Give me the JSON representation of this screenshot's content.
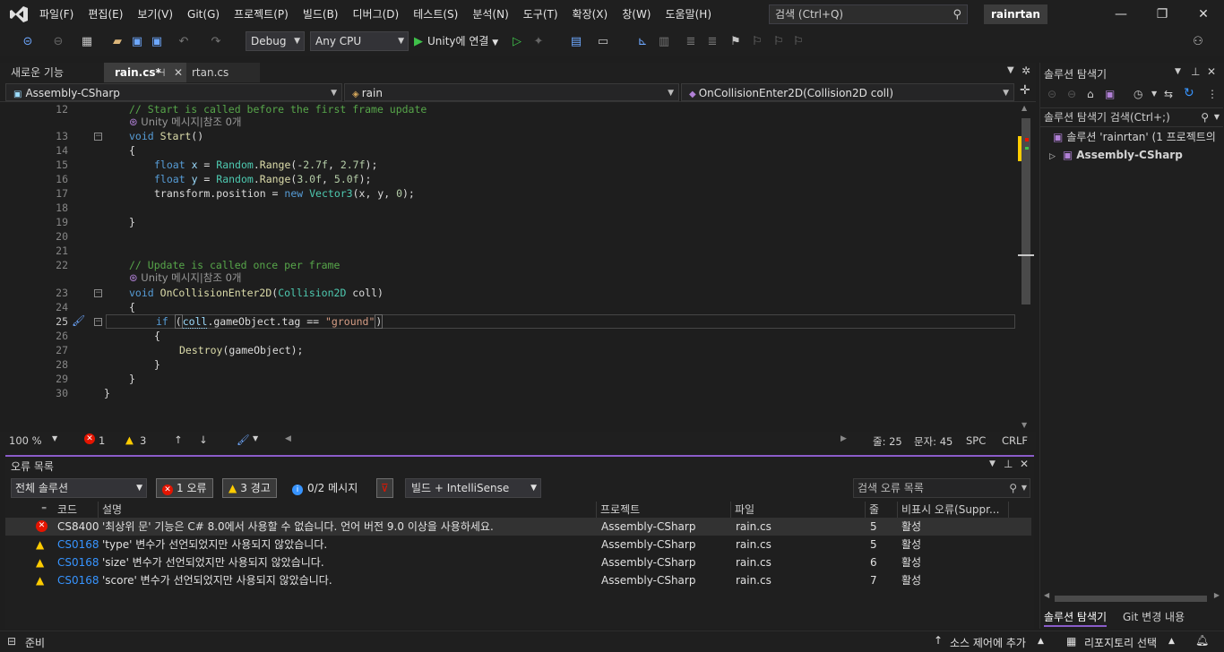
{
  "menu": {
    "items": [
      "파일(F)",
      "편집(E)",
      "보기(V)",
      "Git(G)",
      "프로젝트(P)",
      "빌드(B)",
      "디버그(D)",
      "테스트(S)",
      "분석(N)",
      "도구(T)",
      "확장(X)",
      "창(W)",
      "도움말(H)"
    ],
    "search_placeholder": "검색 (Ctrl+Q)",
    "solution_name": "rainrtan"
  },
  "toolbar": {
    "config": "Debug",
    "platform": "Any CPU",
    "run_label": "Unity에 연결"
  },
  "tabs": {
    "new_features": "새로운 기능",
    "active": "rain.cs*",
    "other": "rtan.cs"
  },
  "navbar": {
    "project": "Assembly-CSharp",
    "type": "rain",
    "member": "OnCollisionEnter2D(Collision2D coll)"
  },
  "code": {
    "line_numbers": [
      "12",
      "13",
      "14",
      "15",
      "16",
      "17",
      "18",
      "19",
      "20",
      "21",
      "22",
      "23",
      "24",
      "25",
      "26",
      "27",
      "28",
      "29",
      "30"
    ],
    "l12": "// Start is called before the first frame update",
    "lens1": "Unity 메시지|참조 0개",
    "l13a": "void",
    "l13b": "Start",
    "l13c": "()",
    "l14": "{",
    "l15a": "float",
    "l15b": "x",
    "l15c": " = ",
    "l15d": "Random",
    "l15e": ".",
    "l15f": "Range",
    "l15g": "(-",
    "l15h": "2.7f",
    "l15i": ", ",
    "l15j": "2.7f",
    "l15k": ");",
    "l16a": "float",
    "l16b": "y",
    "l16c": " = ",
    "l16d": "Random",
    "l16e": ".",
    "l16f": "Range",
    "l16g": "(",
    "l16h": "3.0f",
    "l16i": ", ",
    "l16j": "5.0f",
    "l16k": ");",
    "l17a": "transform.position = ",
    "l17b": "new",
    "l17c": "Vector3",
    "l17d": "(x, y, ",
    "l17e": "0",
    "l17f": ");",
    "l19": "}",
    "l22": "// Update is called once per frame",
    "lens2": "Unity 메시지|참조 0개",
    "l23a": "void",
    "l23b": "OnCollisionEnter2D",
    "l23c": "(",
    "l23d": "Collision2D",
    "l23e": " coll)",
    "l24": "{",
    "l25a": "if",
    "l25b": "(",
    "l25c": "coll",
    "l25d": ".gameObject.tag == ",
    "l25e": "\"ground\"",
    "l25f": ")",
    "l26": "{",
    "l27a": "Destroy",
    "l27b": "(gameObject);",
    "l28": "}",
    "l29": "}",
    "l30": "}"
  },
  "editor_status": {
    "zoom": "100 %",
    "errors": "1",
    "warnings": "3",
    "line": "줄: 25",
    "col": "문자: 45",
    "spc": "SPC",
    "crlf": "CRLF"
  },
  "error_list": {
    "title": "오류 목록",
    "scope": "전체 솔루션",
    "errors_btn": "1 오류",
    "warnings_btn": "3 경고",
    "messages_btn": "0/2 메시지",
    "build_filter": "빌드 + IntelliSense",
    "search_placeholder": "검색 오류 목록",
    "headers": {
      "code": "코드",
      "desc": "설명",
      "project": "프로젝트",
      "file": "파일",
      "line": "줄",
      "suppress": "비표시 오류(Suppr..."
    },
    "rows": [
      {
        "code": "CS8400",
        "desc": "'최상위 문' 기능은 C# 8.0에서 사용할 수 없습니다. 언어 버전 9.0 이상을 사용하세요.",
        "project": "Assembly-CSharp",
        "file": "rain.cs",
        "line": "5",
        "state": "활성"
      },
      {
        "code": "CS0168",
        "desc": "'type' 변수가 선언되었지만 사용되지 않았습니다.",
        "project": "Assembly-CSharp",
        "file": "rain.cs",
        "line": "5",
        "state": "활성"
      },
      {
        "code": "CS0168",
        "desc": "'size' 변수가 선언되었지만 사용되지 않았습니다.",
        "project": "Assembly-CSharp",
        "file": "rain.cs",
        "line": "6",
        "state": "활성"
      },
      {
        "code": "CS0168",
        "desc": "'score' 변수가 선언되었지만 사용되지 않았습니다.",
        "project": "Assembly-CSharp",
        "file": "rain.cs",
        "line": "7",
        "state": "활성"
      }
    ]
  },
  "solution_explorer": {
    "title": "솔루션 탐색기",
    "search_placeholder": "솔루션 탐색기 검색(Ctrl+;)",
    "solution_node": "솔루션 'rainrtan' (1 프로젝트의",
    "project_node": "Assembly-CSharp",
    "tab_active": "솔루션 탐색기",
    "tab_git": "Git 변경 내용"
  },
  "status": {
    "ready": "준비",
    "source_control": "소스 제어에 추가",
    "repo": "리포지토리 선택"
  },
  "colors": {
    "purple_accent": "#8a5cc9",
    "error_red": "#e51400",
    "warning_yellow": "#ffcc00",
    "link_blue": "#3794ff"
  }
}
